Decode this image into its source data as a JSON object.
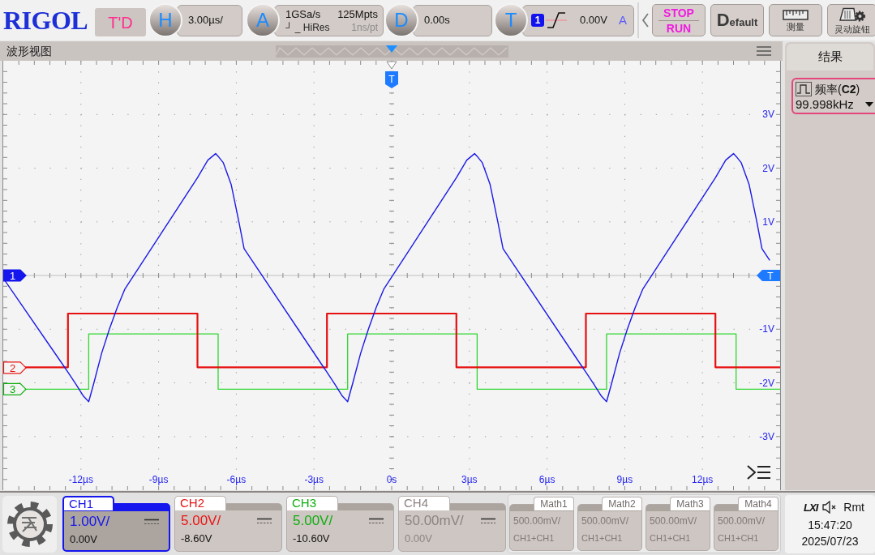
{
  "top_bar": {
    "logo": "RIGOL",
    "mode_badge": "T'D",
    "horizontal": {
      "key": "H",
      "value": "3.00µs/"
    },
    "acquisition": {
      "key": "A",
      "sample_rate": "1GSa/s",
      "memory_depth": "125Mpts",
      "mode": "┘ _ HiRes",
      "resolution": "1ns/pt"
    },
    "delay": {
      "key": "D",
      "value": "0.00s"
    },
    "trigger": {
      "key": "T",
      "source": "1",
      "level": "0.00V",
      "sweep": "A"
    },
    "buttons": [
      {
        "kind": "run_stop",
        "lines": [
          "STOP",
          "RUN"
        ]
      },
      {
        "kind": "default",
        "label": "Default"
      },
      {
        "kind": "measure",
        "label": "测量"
      },
      {
        "kind": "knob",
        "label": "灵动旋钮"
      }
    ]
  },
  "waveform_view": {
    "title": "波形视图",
    "trigger_position_marker": "T",
    "trigger_level_marker": "T",
    "chart_data": {
      "type": "line",
      "grid": true,
      "xlim": [
        -15,
        15
      ],
      "ylim": [
        -4,
        4
      ],
      "xticks": [
        {
          "value": -12,
          "label": "-12µs"
        },
        {
          "value": -9,
          "label": "-9µs"
        },
        {
          "value": -6,
          "label": "-6µs"
        },
        {
          "value": -3,
          "label": "-3µs"
        },
        {
          "value": 0,
          "label": "0s"
        },
        {
          "value": 3,
          "label": "3µs"
        },
        {
          "value": 6,
          "label": "6µs"
        },
        {
          "value": 9,
          "label": "9µs"
        },
        {
          "value": 12,
          "label": "12µs"
        }
      ],
      "yticks": [
        {
          "value": 3,
          "label": "3V"
        },
        {
          "value": 2,
          "label": "2V"
        },
        {
          "value": 1,
          "label": "1V"
        },
        {
          "value": -1,
          "label": "-1V"
        },
        {
          "value": -2,
          "label": "-2V"
        },
        {
          "value": -3,
          "label": "-3V"
        }
      ],
      "x": [
        -15,
        -12.7,
        -12.5,
        -12.5,
        -12.2,
        -11.9,
        -11.7,
        -11.7,
        -11.5,
        -11.2,
        -10.9,
        -10.6,
        -10.3,
        -7.5,
        -7.5,
        -7.1,
        -6.8,
        -6.7,
        -6.7,
        -6.5,
        -6.2,
        -5.9,
        -5.7,
        -2.7,
        -2.5,
        -2.5,
        -2.2,
        -1.9,
        -1.7,
        -1.7,
        -1.5,
        -1.2,
        -0.9,
        -0.6,
        -0.3,
        2.5,
        2.5,
        2.9,
        3.2,
        3.3,
        3.3,
        3.5,
        3.8,
        4.1,
        4.3,
        7.3,
        7.5,
        7.5,
        7.8,
        8.1,
        8.3,
        8.3,
        8.5,
        8.8,
        9.1,
        9.4,
        9.7,
        12.5,
        12.5,
        12.9,
        13.2,
        13.3,
        13.3,
        13.5,
        13.8,
        14.1,
        14.3,
        14.6,
        15
      ],
      "series": [
        {
          "color": "#1a1ae6",
          "values": [
            -0.05,
            -1.66,
            -1.8,
            -1.8,
            -2.02,
            -2.25,
            -2.35,
            -2.35,
            -2.0,
            -1.45,
            -1.0,
            -0.6,
            -0.25,
            1.82,
            1.82,
            2.15,
            2.27,
            2.22,
            2.22,
            2.1,
            1.7,
            1.0,
            0.5,
            -1.66,
            -1.8,
            -1.8,
            -2.02,
            -2.25,
            -2.35,
            -2.35,
            -2.0,
            -1.45,
            -1.0,
            -0.6,
            -0.25,
            1.82,
            1.82,
            2.15,
            2.27,
            2.22,
            2.22,
            2.1,
            1.7,
            1.0,
            0.5,
            -1.66,
            -1.8,
            -1.8,
            -2.02,
            -2.25,
            -2.35,
            -2.35,
            -2.0,
            -1.45,
            -1.0,
            -0.6,
            -0.25,
            1.82,
            1.82,
            2.15,
            2.27,
            2.22,
            2.22,
            2.1,
            1.7,
            1.0,
            0.5,
            0.28,
            null
          ]
        },
        {
          "color": "#e61010",
          "values": [
            -1.71,
            -1.71,
            -1.71,
            -0.71,
            -0.71,
            -0.71,
            -0.71,
            -0.71,
            -0.71,
            -0.71,
            -0.71,
            -0.71,
            -0.71,
            -0.71,
            -1.71,
            -1.71,
            -1.71,
            -1.71,
            -1.71,
            -1.71,
            -1.71,
            -1.71,
            -1.71,
            -1.71,
            -1.71,
            -0.71,
            -0.71,
            -0.71,
            -0.71,
            -0.71,
            -0.71,
            -0.71,
            -0.71,
            -0.71,
            -0.71,
            -0.71,
            -1.71,
            -1.71,
            -1.71,
            -1.71,
            -1.71,
            -1.71,
            -1.71,
            -1.71,
            -1.71,
            -1.71,
            -1.71,
            -0.71,
            -0.71,
            -0.71,
            -0.71,
            -0.71,
            -0.71,
            -0.71,
            -0.71,
            -0.71,
            -0.71,
            -0.71,
            -1.71,
            -1.71,
            -1.71,
            -1.71,
            -1.71,
            -1.71,
            -1.71,
            -1.71,
            -1.71,
            -1.71,
            -1.71
          ]
        },
        {
          "color": "#2fd82f",
          "values": [
            -2.12,
            -2.12,
            -2.12,
            -2.12,
            -2.12,
            -2.12,
            -2.12,
            -1.09,
            -1.09,
            -1.09,
            -1.09,
            -1.09,
            -1.09,
            -1.09,
            -1.09,
            -1.09,
            -1.09,
            -1.09,
            -2.12,
            -2.12,
            -2.12,
            -2.12,
            -2.12,
            -2.12,
            -2.12,
            -2.12,
            -2.12,
            -2.12,
            -2.12,
            -1.09,
            -1.09,
            -1.09,
            -1.09,
            -1.09,
            -1.09,
            -1.09,
            -1.09,
            -1.09,
            -1.09,
            -1.09,
            -2.12,
            -2.12,
            -2.12,
            -2.12,
            -2.12,
            -2.12,
            -2.12,
            -2.12,
            -2.12,
            -2.12,
            -2.12,
            -1.09,
            -1.09,
            -1.09,
            -1.09,
            -1.09,
            -1.09,
            -1.09,
            -1.09,
            -1.09,
            -1.09,
            -1.09,
            -2.12,
            -2.12,
            -2.12,
            -2.12,
            -2.12,
            -2.12,
            -2.12
          ]
        }
      ]
    }
  },
  "results_panel": {
    "title": "结果",
    "measurements": [
      {
        "label": "频率(**C2**)",
        "value": "99.998kHz"
      }
    ]
  },
  "channels": [
    {
      "label": "CH1",
      "marker": "1",
      "scale": "1.00V/",
      "offset": "0.00V",
      "color": "#1515ee",
      "on": true,
      "selected": true
    },
    {
      "label": "CH2",
      "marker": "2",
      "scale": "5.00V/",
      "offset": "-8.60V",
      "color": "#e81515",
      "on": true,
      "selected": false
    },
    {
      "label": "CH3",
      "marker": "3",
      "scale": "5.00V/",
      "offset": "-10.60V",
      "color": "#0fae0f",
      "on": true,
      "selected": false
    },
    {
      "label": "CH4",
      "scale": "50.00mV/",
      "offset": "0.00V",
      "on": false,
      "selected": false
    }
  ],
  "math_channels": [
    {
      "label": "Math1",
      "scale": "500.00mV/",
      "source": "CH1+CH1"
    },
    {
      "label": "Math2",
      "scale": "500.00mV/",
      "source": "CH1+CH1"
    },
    {
      "label": "Math3",
      "scale": "500.00mV/",
      "source": "CH1+CH1"
    },
    {
      "label": "Math4",
      "scale": "500.00mV/",
      "source": "CH1+CH1"
    }
  ],
  "status": {
    "lxi": "LXI",
    "remote": "Rmt",
    "time": "15:47:20",
    "date": "2025/07/23"
  }
}
